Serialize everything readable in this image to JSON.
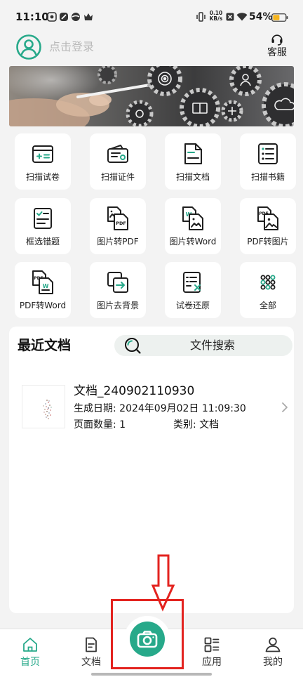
{
  "status_bar": {
    "time": "11:10",
    "notification_icons": [
      "app-notification-icon",
      "link-notification-icon",
      "ball-notification-icon",
      "crown-notification-icon"
    ],
    "net_speed": {
      "value": "0.10",
      "unit": "KB/s"
    },
    "battery_text": "54%",
    "battery_level": 0.54
  },
  "header": {
    "login_text": "点击登录",
    "service_label": "客服"
  },
  "tools": [
    {
      "label": "扫描试卷",
      "icon": "scan-paper-icon"
    },
    {
      "label": "扫描证件",
      "icon": "scan-id-icon"
    },
    {
      "label": "扫描文档",
      "icon": "scan-document-icon"
    },
    {
      "label": "扫描书籍",
      "icon": "scan-book-icon"
    },
    {
      "label": "框选错题",
      "icon": "select-question-icon"
    },
    {
      "label": "图片转PDF",
      "icon": "image-to-pdf-icon",
      "icon_text": "PDF"
    },
    {
      "label": "图片转Word",
      "icon": "image-to-word-icon",
      "icon_text": "W"
    },
    {
      "label": "PDF转图片",
      "icon": "pdf-to-image-icon",
      "icon_text": "PDF"
    },
    {
      "label": "PDF转Word",
      "icon": "pdf-to-word-icon",
      "icon_text": "PDF",
      "icon_text_2": "W"
    },
    {
      "label": "图片去背景",
      "icon": "remove-background-icon"
    },
    {
      "label": "试卷还原",
      "icon": "restore-paper-icon"
    },
    {
      "label": "全部",
      "icon": "all-apps-icon"
    }
  ],
  "recent": {
    "title": "最近文档",
    "search_label": "文件搜索",
    "documents": [
      {
        "name": "文档_240902110930",
        "date_label": "生成日期:",
        "date": "2024年09月02日 11:09:30",
        "pages_label": "页面数量:",
        "pages": "1",
        "category_label": "类别:",
        "category": "文档"
      }
    ]
  },
  "nav": {
    "items": [
      {
        "label": "首页",
        "icon": "home-icon",
        "active": true
      },
      {
        "label": "文档",
        "icon": "document-icon",
        "active": false
      },
      {
        "label": "应用",
        "icon": "apps-icon",
        "active": false
      },
      {
        "label": "我的",
        "icon": "profile-icon",
        "active": false
      }
    ],
    "center_icon": "camera-icon"
  },
  "colors": {
    "accent": "#27a98a",
    "annotation": "#e3231f",
    "battery": "#f4b41e",
    "background": "#f3f3f3"
  }
}
